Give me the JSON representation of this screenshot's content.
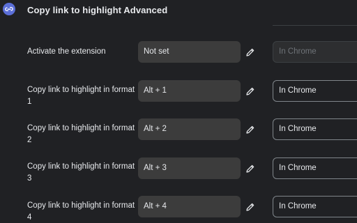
{
  "header": {
    "title": "Copy link to highlight Advanced",
    "icon": "extension-link-icon"
  },
  "rows": [
    {
      "label": "Activate the extension",
      "shortcut": "Not set",
      "scope": "In Chrome"
    },
    {
      "label": "Copy link to highlight in format 1",
      "shortcut": "Alt + 1",
      "scope": "In Chrome"
    },
    {
      "label": "Copy link to highlight in format 2",
      "shortcut": "Alt + 2",
      "scope": "In Chrome"
    },
    {
      "label": "Copy link to highlight in format 3",
      "shortcut": "Alt + 3",
      "scope": "In Chrome"
    },
    {
      "label": "Copy link to highlight in format 4",
      "shortcut": "Alt + 4",
      "scope": "In Chrome"
    }
  ],
  "colors": {
    "background": "#202124",
    "field": "#3c3c3c",
    "text": "#e8eaed",
    "disabled_text": "#6f7378",
    "icon_accent": "#5b6fd8"
  }
}
